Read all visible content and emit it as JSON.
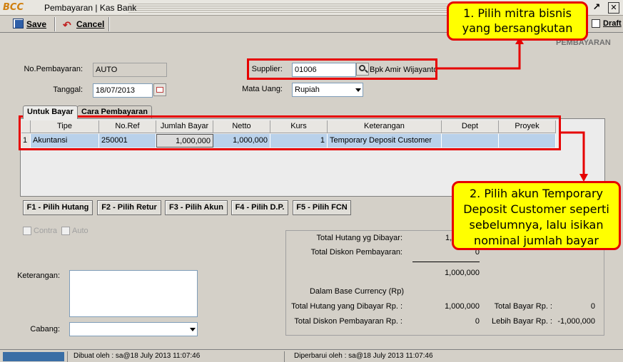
{
  "window": {
    "logo_text": "BCC",
    "title": "Pembayaran | Kas Bank",
    "restore_icon": "restore-icon",
    "close_icon": "close-icon"
  },
  "toolbar": {
    "save_label": "Save",
    "cancel_label": "Cancel",
    "draft_label": "Draft"
  },
  "form": {
    "section_title": "PEMBAYARAN",
    "no_pembayaran_label": "No.Pembayaran:",
    "no_pembayaran_value": "AUTO",
    "tanggal_label": "Tanggal:",
    "tanggal_value": "18/07/2013",
    "supplier_label": "Supplier:",
    "supplier_code": "01006",
    "supplier_name": "Bpk Amir Wijayanto",
    "mata_uang_label": "Mata Uang:",
    "mata_uang_value": "Rupiah"
  },
  "tabs": [
    {
      "label": "Untuk Bayar",
      "active": true
    },
    {
      "label": "Cara Pembayaran",
      "active": false
    }
  ],
  "grid": {
    "columns": [
      "Tipe",
      "No.Ref",
      "Jumlah Bayar",
      "Netto",
      "Kurs",
      "Keterangan",
      "Dept",
      "Proyek"
    ],
    "rows": [
      {
        "no": "1",
        "tipe": "Akuntansi",
        "no_ref": "250001",
        "jumlah_bayar": "1,000,000",
        "netto": "1,000,000",
        "kurs": "1",
        "keterangan": "Temporary Deposit Customer",
        "dept": "",
        "proyek": ""
      }
    ]
  },
  "function_buttons": [
    "F1 - Pilih Hutang",
    "F2 - Pilih Retur",
    "F3 - Pilih Akun",
    "F4 - Pilih D.P.",
    "F5 - Pilih FCN"
  ],
  "options": {
    "contra_label": "Contra",
    "auto_label": "Auto"
  },
  "notes": {
    "keterangan_label": "Keterangan:",
    "cabang_label": "Cabang:"
  },
  "totals": {
    "total_hutang_label": "Total Hutang yg Dibayar:",
    "total_hutang_value": "1,",
    "total_diskon_label": "Total Diskon Pembayaran:",
    "total_diskon_value": "0",
    "subtotal_value": "1,000,000",
    "base_currency_label": "Dalam Base Currency (Rp)",
    "total_hutang_rp_label": "Total Hutang yang Dibayar Rp. :",
    "total_hutang_rp_value": "1,000,000",
    "total_diskon_rp_label": "Total Diskon Pembayaran Rp. :",
    "total_diskon_rp_value": "0",
    "total_bayar_rp_label": "Total Bayar Rp. :",
    "total_bayar_rp_value": "0",
    "lebih_bayar_rp_label": "Lebih Bayar Rp. :",
    "lebih_bayar_rp_value": "-1,000,000"
  },
  "status": {
    "dibuat": "Dibuat oleh : sa@18 July 2013  11:07:46",
    "diperbarui": "Diperbarui oleh : sa@18 July 2013  11:07:46"
  },
  "annotations": {
    "callout1_line1": "1. Pilih mitra bisnis",
    "callout1_line2": "yang bersangkutan",
    "callout2_line1": "2. Pilih akun Temporary",
    "callout2_line2": "Deposit Customer seperti",
    "callout2_line3": "sebelumnya, lalu isikan",
    "callout2_line4": "nominal jumlah bayar",
    "color": "#e60000",
    "fill": "#ffff00"
  }
}
